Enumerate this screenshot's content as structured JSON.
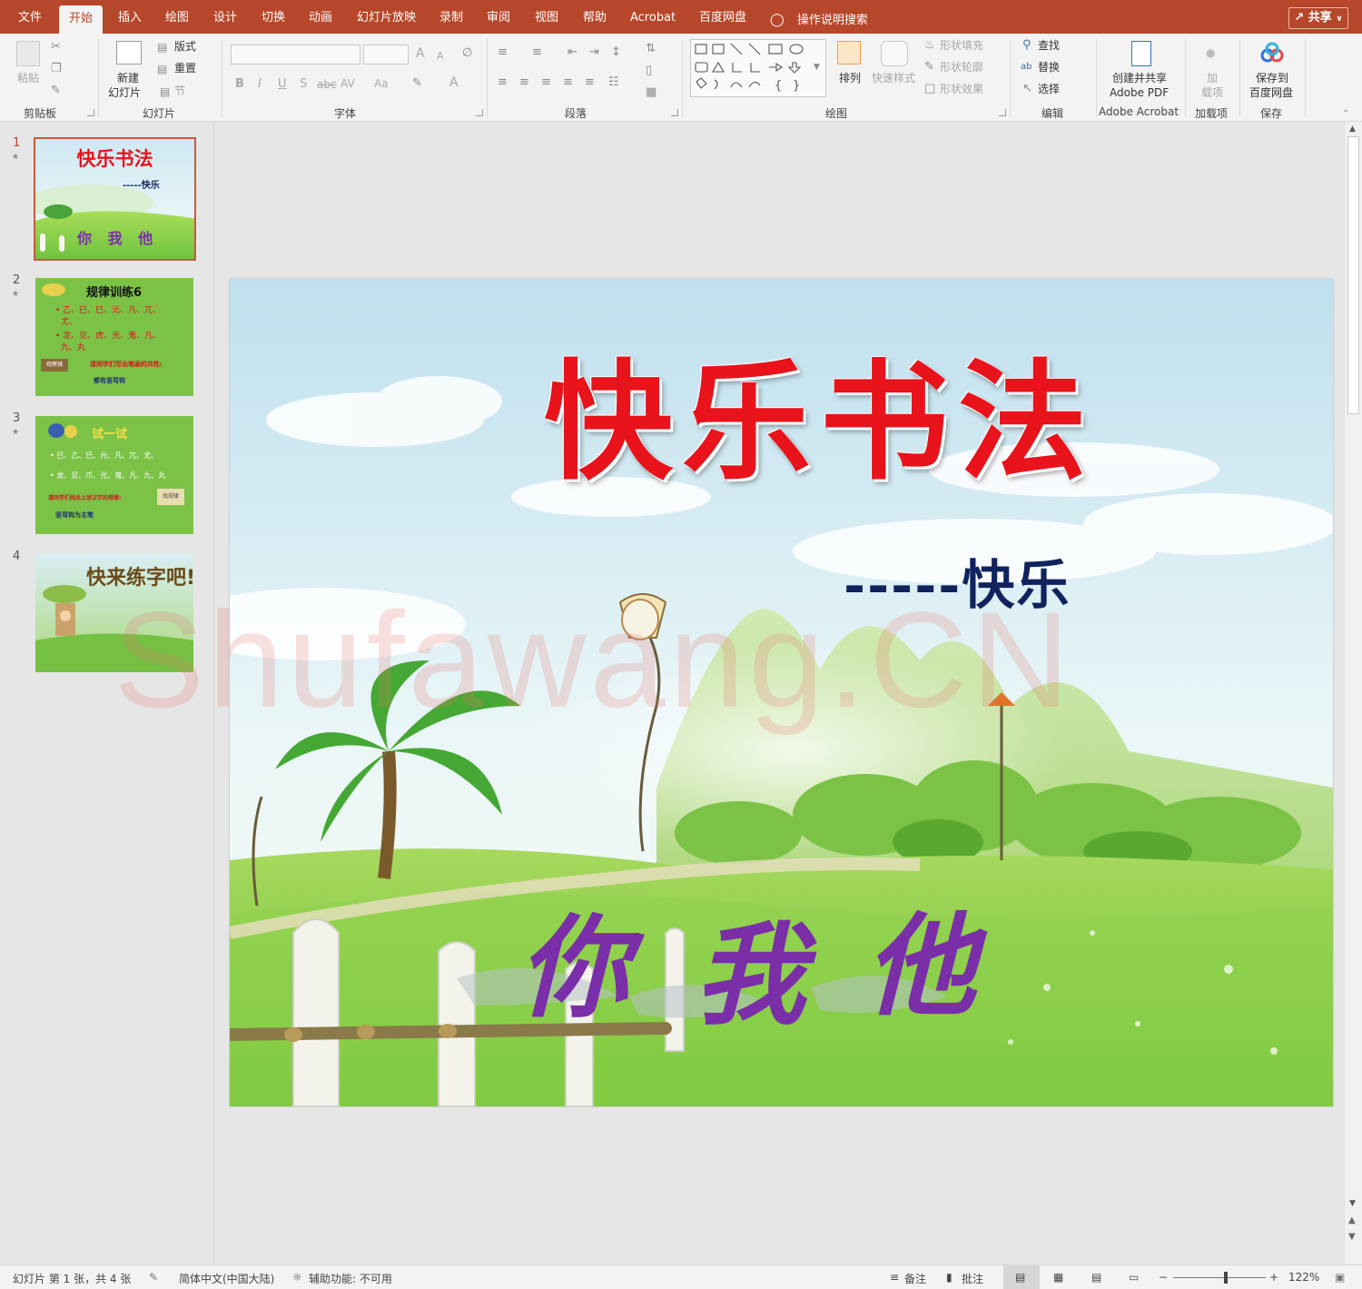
{
  "tabs": [
    "文件",
    "开始",
    "插入",
    "绘图",
    "设计",
    "切换",
    "动画",
    "幻灯片放映",
    "录制",
    "审阅",
    "视图",
    "帮助",
    "Acrobat",
    "百度网盘"
  ],
  "search_label": "操作说明搜索",
  "share_label": "共享",
  "ribbon": {
    "clipboard": {
      "paste": "粘贴",
      "group": "剪贴板"
    },
    "slides": {
      "new_slide_1": "新建",
      "new_slide_2": "幻灯片",
      "layout": "版式",
      "reset": "重置",
      "section": "节",
      "group": "幻灯片"
    },
    "font": {
      "group": "字体",
      "bold": "B",
      "italic": "I",
      "underline": "U",
      "strike": "S",
      "abc": "abc",
      "spacing": "AV",
      "case": "Aa",
      "grow": "A",
      "shrink": "A",
      "color": "A"
    },
    "paragraph": {
      "group": "段落"
    },
    "drawing": {
      "arrange": "排列",
      "quick_styles": "快速样式",
      "shape_fill": "形状填充",
      "shape_outline": "形状轮廓",
      "shape_effects": "形状效果",
      "group": "绘图"
    },
    "editing": {
      "find": "查找",
      "replace": "替换",
      "select": "选择",
      "group": "编辑"
    },
    "acrobat": {
      "line1": "创建并共享",
      "line2": "Adobe PDF",
      "group": "Adobe Acrobat"
    },
    "addins": {
      "line1": "加",
      "line2": "载项",
      "group": "加载项"
    },
    "save": {
      "line1": "保存到",
      "line2": "百度网盘",
      "group": "保存"
    }
  },
  "slides": [
    {
      "number": "1",
      "title": "快乐书法",
      "subtitle": "-----快乐",
      "chars": "你 我 他"
    },
    {
      "number": "2",
      "title": "规律训练6",
      "line1": "• 乙、已、巳、元、凡、兀、",
      "line2": "尤、",
      "line3": "• 龙、见、虎、光、鬼、凡、",
      "line4": "九、丸",
      "sign": "观察镜",
      "hint": "请同学们写出笔画的共性:",
      "hint2": "都有竖弯钩"
    },
    {
      "number": "3",
      "title": "试一试",
      "line1": "• 已、乙、巳、元、凡、兀、尤、",
      "line2": "• 龙、见、爪、光、鬼、凡、九、丸",
      "hint": "请同学们找出上述汉字的规律:",
      "hint2": "竖弯钩为主笔",
      "sign": "找规律"
    },
    {
      "number": "4",
      "title": "快来练字吧!"
    }
  ],
  "main_slide": {
    "title": "快乐书法",
    "subtitle": "-----快乐",
    "char1": "你",
    "char2": "我",
    "char3": "他"
  },
  "watermark": "Shufawang.CN",
  "status": {
    "slide_info": "幻灯片 第 1 张，共 4 张",
    "language": "简体中文(中国大陆)",
    "accessibility": "辅助功能: 不可用",
    "notes": "备注",
    "comments": "批注",
    "zoom": "122%"
  },
  "zoom_level": 1.22,
  "colors": {
    "accent": "#b7472a",
    "title_red": "#e8131b",
    "subtitle_navy": "#10235e",
    "chars_purple": "#7a2ea8"
  }
}
